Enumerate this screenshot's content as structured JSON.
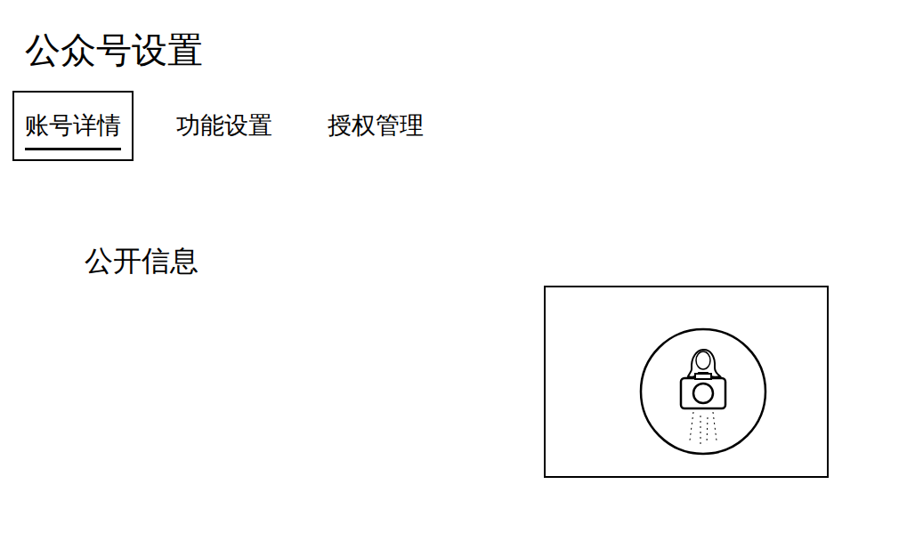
{
  "page": {
    "title": "公众号设置"
  },
  "tabs": [
    {
      "label": "账号详情",
      "selected": true
    },
    {
      "label": "功能设置",
      "selected": false
    },
    {
      "label": "授权管理",
      "selected": false
    }
  ],
  "section": {
    "heading": "公开信息"
  }
}
